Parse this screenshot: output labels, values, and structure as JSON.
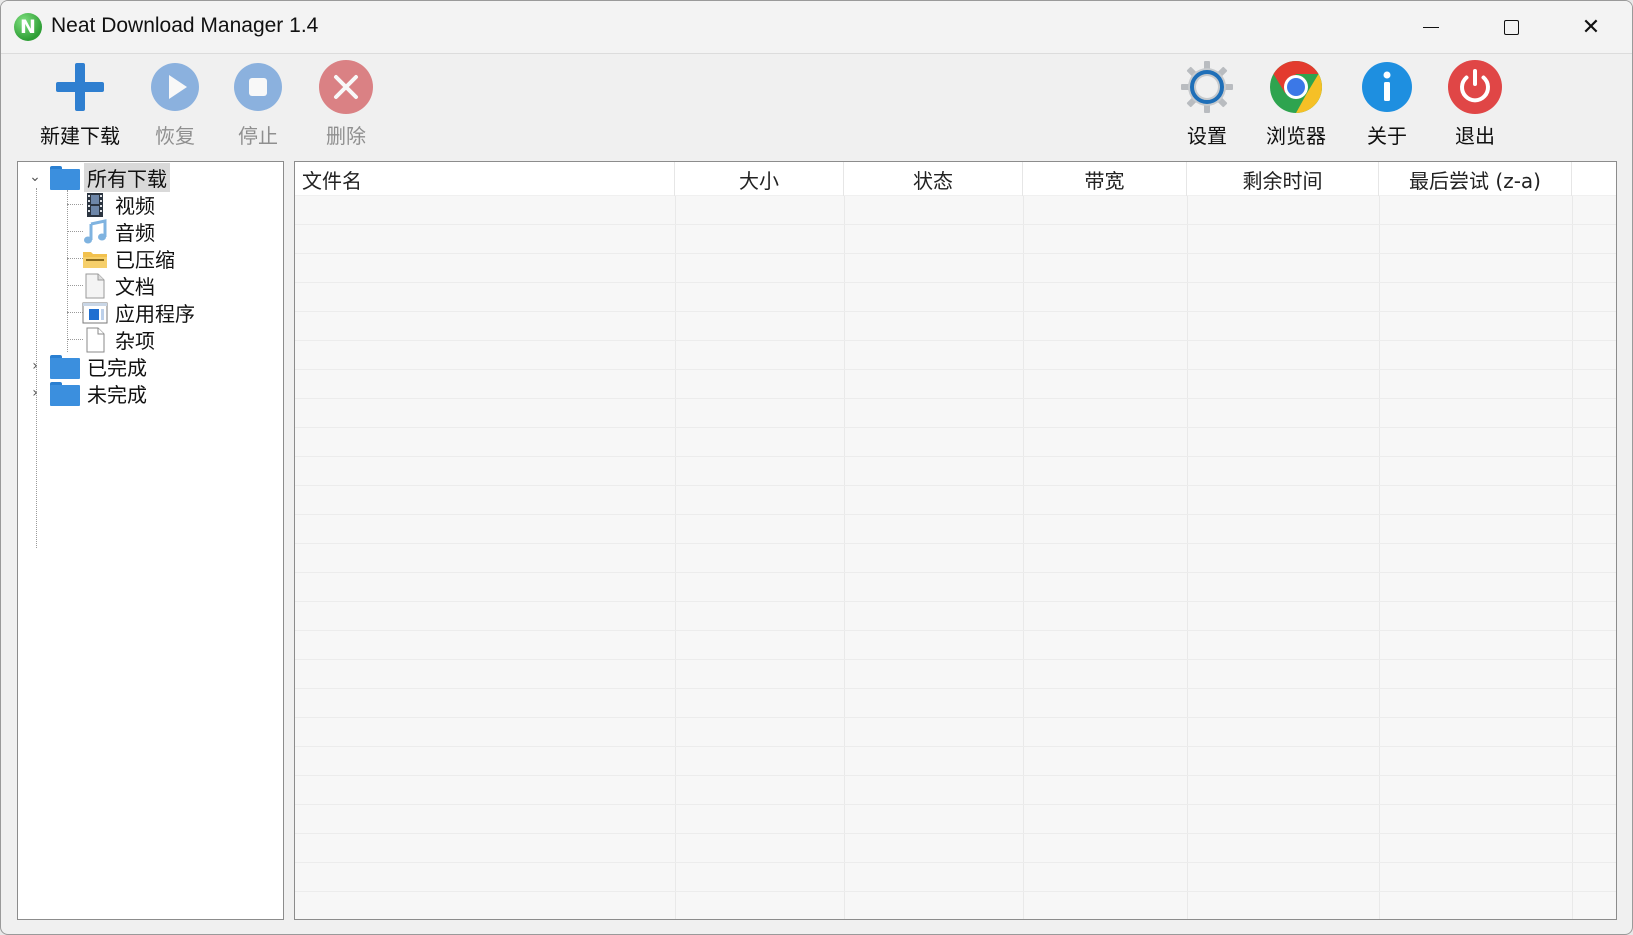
{
  "window": {
    "title": "Neat Download Manager 1.4",
    "app_icon_letter": "N",
    "controls": {
      "minimize": "minimize-icon",
      "maximize": "maximize-icon",
      "close": "✕"
    }
  },
  "toolbar": {
    "left": [
      {
        "label": "新建下载",
        "icon": "plus-icon",
        "enabled": true
      },
      {
        "label": "恢复",
        "icon": "play-icon",
        "enabled": false
      },
      {
        "label": "停止",
        "icon": "stop-icon",
        "enabled": false
      },
      {
        "label": "删除",
        "icon": "delete-icon",
        "enabled": false
      }
    ],
    "right": [
      {
        "label": "设置",
        "icon": "gear-icon"
      },
      {
        "label": "浏览器",
        "icon": "chrome-icon"
      },
      {
        "label": "关于",
        "icon": "info-icon"
      },
      {
        "label": "退出",
        "icon": "power-icon"
      }
    ]
  },
  "tree": {
    "root": {
      "label": "所有下载",
      "expanded": true,
      "selected": true
    },
    "children": [
      {
        "label": "视频",
        "icon": "film-icon"
      },
      {
        "label": "音频",
        "icon": "music-icon"
      },
      {
        "label": "已压缩",
        "icon": "archive-folder-icon"
      },
      {
        "label": "文档",
        "icon": "document-icon"
      },
      {
        "label": "应用程序",
        "icon": "application-icon"
      },
      {
        "label": "杂项",
        "icon": "blank-file-icon"
      }
    ],
    "others": [
      {
        "label": "已完成",
        "expanded": false
      },
      {
        "label": "未完成",
        "expanded": false
      }
    ]
  },
  "list": {
    "columns": [
      "文件名",
      "大小",
      "状态",
      "带宽",
      "剩余时间",
      "最后尝试 (z-a)"
    ],
    "rows": []
  },
  "colors": {
    "accent_blue": "#2a7fd1",
    "exit_red": "#e04646",
    "info_blue": "#1e8fe0"
  }
}
